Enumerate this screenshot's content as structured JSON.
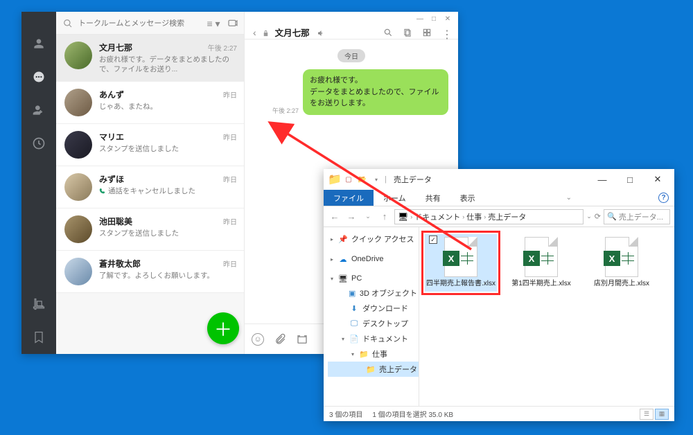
{
  "line": {
    "search_placeholder": "トークルームとメッセージ検索",
    "chats": [
      {
        "name": "文月七那",
        "time": "午後 2:27",
        "preview": "お疲れ様です。データをまとめましたので、ファイルをお送り...",
        "active": true
      },
      {
        "name": "あんず",
        "time": "昨日",
        "preview": "じゃあ、またね。"
      },
      {
        "name": "マリエ",
        "time": "昨日",
        "preview": "スタンプを送信しました"
      },
      {
        "name": "みずほ",
        "time": "昨日",
        "preview": "通話をキャンセルしました",
        "preview_icon": "phone"
      },
      {
        "name": "池田聡美",
        "time": "昨日",
        "preview": "スタンプを送信しました"
      },
      {
        "name": "蒼井敬太郎",
        "time": "昨日",
        "preview": "了解です。よろしくお願いします。"
      }
    ],
    "active_chat_title": "文月七那",
    "date_label": "今日",
    "msg_time": "午後 2:27",
    "msg_text": "お疲れ様です。\nデータをまとめましたので、ファイルをお送りします。"
  },
  "explorer": {
    "window_title": "売上データ",
    "tabs": {
      "file": "ファイル",
      "home": "ホーム",
      "share": "共有",
      "view": "表示"
    },
    "breadcrumb": [
      "ドキュメント",
      "仕事",
      "売上データ"
    ],
    "search_placeholder": "売上データ...",
    "tree": {
      "quick": "クイック アクセス",
      "onedrive": "OneDrive",
      "pc": "PC",
      "pc_children": [
        "3D オブジェクト",
        "ダウンロード",
        "デスクトップ",
        "ドキュメント"
      ],
      "doc_children": [
        "仕事"
      ],
      "shigoto_children": [
        "売上データ"
      ]
    },
    "files": [
      {
        "name": "四半期売上報告書.xlsx",
        "selected": true,
        "highlighted": true
      },
      {
        "name": "第1四半期売上.xlsx"
      },
      {
        "name": "店別月間売上.xlsx"
      }
    ],
    "status": {
      "count": "3 個の項目",
      "selected": "1 個の項目を選択 35.0 KB"
    }
  }
}
